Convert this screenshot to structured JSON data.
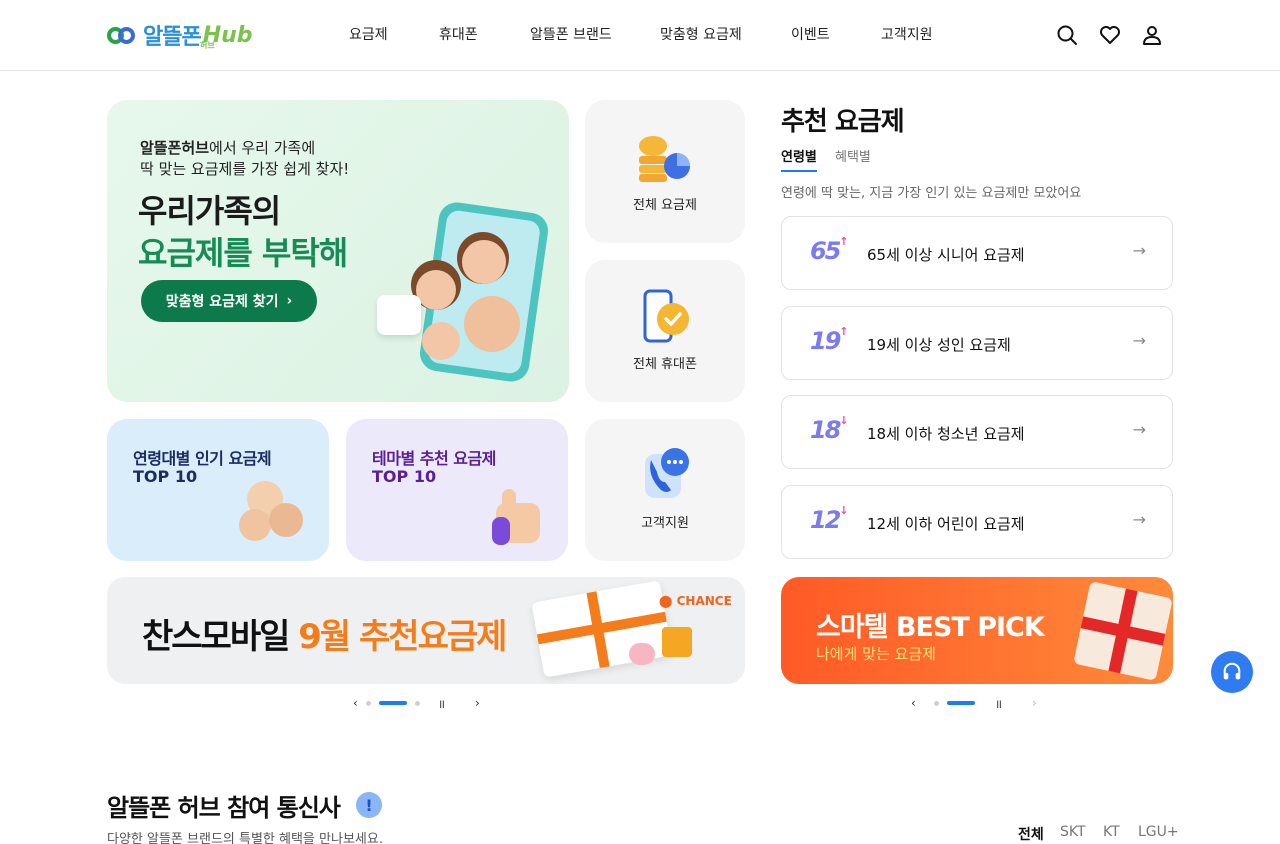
{
  "header": {
    "logo_text": "알뜰폰",
    "logo_hub": "Hub",
    "logo_sub": "허브",
    "nav": [
      "요금제",
      "휴대폰",
      "알뜰폰 브랜드",
      "맞춤형 요금제",
      "이벤트",
      "고객지원"
    ],
    "icons": [
      "search-icon",
      "heart-icon",
      "user-icon"
    ]
  },
  "hero": {
    "sub_bold": "알뜰폰허브",
    "sub_rest": "에서 우리 가족에",
    "sub_line2": "딱 맞는 요금제를 가장 쉽게 찾자!",
    "title_line1": "우리가족의",
    "title_line2": "요금제를 부탁해",
    "cta": "맞춤형 요금제 찾기"
  },
  "tiles": {
    "all_plans": "전체 요금제",
    "all_phones": "전체 휴대폰",
    "support": "고객지원"
  },
  "promo": {
    "age_l1": "연령대별 인기 요금제",
    "age_l2": "TOP 10",
    "theme_l1": "테마별 추천 요금제",
    "theme_l2": "TOP 10"
  },
  "banner": {
    "text_a": "찬스모바일 ",
    "text_b": "9월 추천요금제",
    "brand": "CHANCE"
  },
  "recommend": {
    "title": "추천 요금제",
    "tabs": [
      "연령별",
      "혜택별"
    ],
    "desc": "연령에 딱 맞는, 지금 가장 인기 있는 요금제만 모았어요",
    "plans": [
      {
        "num": "65",
        "arrow": "↑",
        "label": "65세 이상 시니어 요금제"
      },
      {
        "num": "19",
        "arrow": "↑",
        "label": "19세 이상 성인 요금제"
      },
      {
        "num": "18",
        "arrow": "↓",
        "label": "18세 이하 청소년 요금제"
      },
      {
        "num": "12",
        "arrow": "↓",
        "label": "12세 이하 어린이 요금제"
      }
    ]
  },
  "pick": {
    "title": "스마텔 BEST PICK",
    "sub": "나에게 맞는 요금제"
  },
  "carriers": {
    "title": "알뜰폰 허브 참여 통신사",
    "desc": "다양한 알뜰폰 브랜드의 특별한 혜택을 만나보세요.",
    "tabs": [
      "전체",
      "SKT",
      "KT",
      "LGU+"
    ]
  },
  "colors": {
    "accent": "#1e7cf2",
    "hero_green": "#0d7a4c",
    "pick_orange": "#ff5a26"
  }
}
